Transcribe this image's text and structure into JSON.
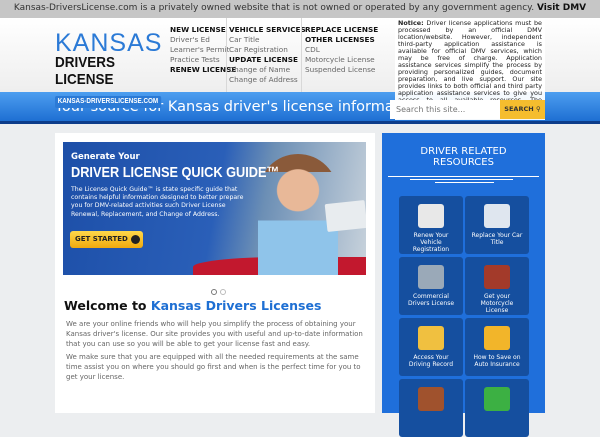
{
  "topbar": {
    "text": "Kansas-DriversLicense.com is a privately owned website that is not owned or operated by any government agency.",
    "link": "Visit DMV"
  },
  "logo": {
    "line1": "KANSAS",
    "line2": "DRIVERS LICENSE",
    "url": "KANSAS-DRIVERSLICENSE.COM"
  },
  "nav": {
    "col1": [
      {
        "label": "NEW LICENSE",
        "head": true
      },
      {
        "label": "Driver's Ed"
      },
      {
        "label": "Learner's Permit"
      },
      {
        "label": "Practice Tests"
      },
      {
        "label": "RENEW LICENSE",
        "head": true
      }
    ],
    "col2": [
      {
        "label": "VEHICLE SERVICES",
        "head": true
      },
      {
        "label": "Car Title"
      },
      {
        "label": "Car Registration"
      },
      {
        "label": "UPDATE LICENSE",
        "head": true
      },
      {
        "label": "Change of Name"
      },
      {
        "label": "Change of Address"
      }
    ],
    "col3": [
      {
        "label": "REPLACE LICENSE",
        "head": true
      },
      {
        "label": "OTHER LICENSES",
        "head": true
      },
      {
        "label": "CDL"
      },
      {
        "label": "Motorcycle License"
      },
      {
        "label": "Suspended License"
      }
    ]
  },
  "notice": {
    "label": "Notice:",
    "text": "Driver license applications must be processed by an official DMV location/website. However, independent third-party application assistance is available for official DMV services, which may be free of charge. Application assistance services simplify the process by providing personalized guides, document preparation, and live support. Our site provides links to both official and third party application assistance services to give you access to all available resources. The information on this site is not guaranteed to"
  },
  "tagline": "Your source for Kansas driver's license information.",
  "search": {
    "placeholder": "Search this site...",
    "button": "SEARCH"
  },
  "banner": {
    "line1": "Generate Your",
    "line2": "DRIVER LICENSE QUICK GUIDE™",
    "body": "The License Quick Guide™ is state specific guide that contains helpful information designed to better prepare you for DMV-related activities such Driver License Renewal, Replacement, and Change of Address.",
    "cta": "GET STARTED"
  },
  "welcome": {
    "title_a": "Welcome to",
    "title_b": "Kansas Drivers Licenses",
    "p1": "We are your online friends who will help you simplify the process of obtaining your Kansas driver's license. Our site provides you with useful and up-to-date information that you can use so you will be able to get your license fast and easy.",
    "p2": "We make sure that you are equipped with all the needed requirements at the same time assist you on where you should go first and when is the perfect time for you to get your license."
  },
  "sidebar": {
    "title": "DRIVER RELATED RESOURCES",
    "tiles": [
      {
        "label": "Renew Your Vehicle Registration",
        "icon": "document-icon",
        "color": "#e8e8e8"
      },
      {
        "label": "Replace Your Car Title",
        "icon": "edit-document-icon",
        "color": "#dfe6ef"
      },
      {
        "label": "Commercial Drivers License",
        "icon": "truck-icon",
        "color": "#9aa9b8"
      },
      {
        "label": "Get your Motorcycle License",
        "icon": "motorcycle-icon",
        "color": "#a33a2a"
      },
      {
        "label": "Access Your Driving Record",
        "icon": "folder-icon",
        "color": "#f0c040"
      },
      {
        "label": "How to Save on Auto Insurance",
        "icon": "car-icon",
        "color": "#f2b52a"
      },
      {
        "label": "",
        "icon": "briefcase-icon",
        "color": "#a0522d"
      },
      {
        "label": "",
        "icon": "checkmark-icon",
        "color": "#3cb043"
      }
    ]
  }
}
